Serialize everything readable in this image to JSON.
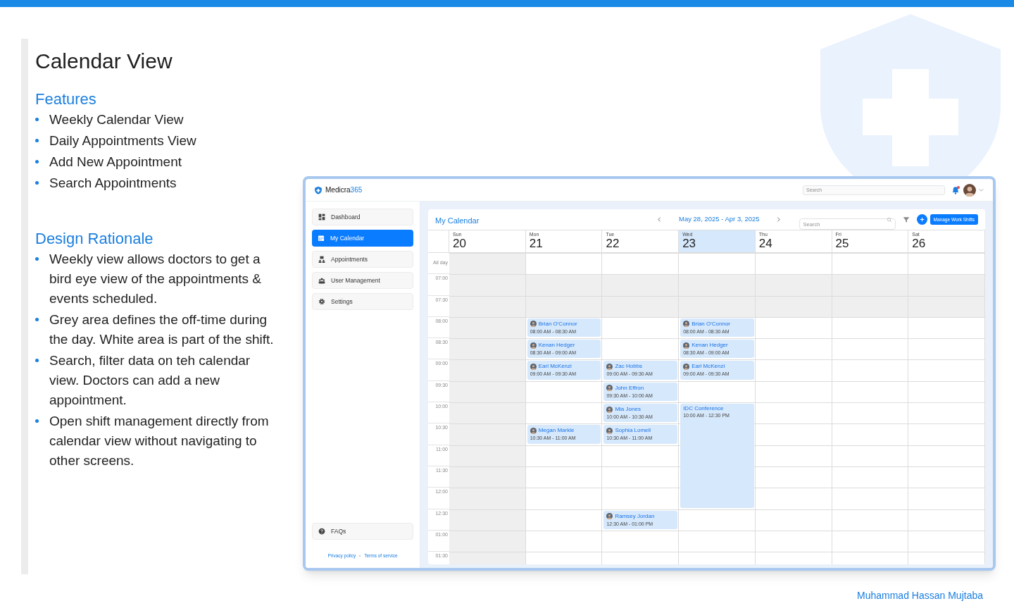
{
  "slide": {
    "title": "Calendar View",
    "sections": [
      {
        "heading": "Features",
        "bullets": [
          "Weekly Calendar View",
          "Daily Appointments View",
          "Add New Appointment",
          "Search Appointments"
        ]
      },
      {
        "heading": "Design Rationale",
        "bullets": [
          "Weekly view allows doctors to get a bird eye view of the appointments & events scheduled.",
          "Grey area defines the off-time during the day. White area is part of the shift.",
          "Search, filter data on teh calendar view. Doctors can add a new appointment.",
          "Open shift management directly from calendar view without navigating to other screens."
        ]
      }
    ],
    "author": "Muhammad Hassan Mujtaba"
  },
  "app": {
    "brand": {
      "name": "Medicra",
      "suffix": "365"
    },
    "header_search": {
      "placeholder": "Search"
    },
    "notifications": {
      "unread": true
    },
    "sidebar": {
      "items": [
        {
          "label": "Dashboard",
          "selected": false
        },
        {
          "label": "My Calendar",
          "selected": true
        },
        {
          "label": "Appointments",
          "selected": false
        },
        {
          "label": "User Management",
          "selected": false
        },
        {
          "label": "Settings",
          "selected": false
        }
      ],
      "footer_items": [
        {
          "label": "FAQs",
          "selected": false
        }
      ],
      "links": [
        "Privacy policy",
        "Terms of service"
      ]
    },
    "calendar": {
      "title": "My Calendar",
      "range": "May 28, 2025 - Apr 3, 2025",
      "search": {
        "placeholder": "Search"
      },
      "button": "Manage Work Shifts",
      "days": [
        {
          "weekday": "Sun",
          "date": "20",
          "selected": false,
          "greyed": true
        },
        {
          "weekday": "Mon",
          "date": "21",
          "selected": false,
          "greyed": false
        },
        {
          "weekday": "Tue",
          "date": "22",
          "selected": false,
          "greyed": false
        },
        {
          "weekday": "Wed",
          "date": "23",
          "selected": true,
          "greyed": false
        },
        {
          "weekday": "Thu",
          "date": "24",
          "selected": false,
          "greyed": false
        },
        {
          "weekday": "Fri",
          "date": "25",
          "selected": false,
          "greyed": false
        },
        {
          "weekday": "Sat",
          "date": "26",
          "selected": false,
          "greyed": false
        }
      ],
      "rows": [
        {
          "label": "All day",
          "kind": "all_day",
          "greyed": false,
          "cells": [
            null,
            null,
            null,
            null,
            null,
            null,
            null
          ]
        },
        {
          "label": "07:00",
          "kind": "time",
          "greyed": true,
          "cells": [
            null,
            null,
            null,
            null,
            null,
            null,
            null
          ]
        },
        {
          "label": "07:30",
          "kind": "time",
          "greyed": true,
          "cells": [
            null,
            null,
            null,
            null,
            null,
            null,
            null
          ]
        },
        {
          "label": "08:00",
          "kind": "time",
          "greyed": false,
          "cells": [
            null,
            {
              "kind": "appointment",
              "name": "Brian O'Connor",
              "time": "08:00 AM - 08:30 AM"
            },
            null,
            {
              "kind": "appointment",
              "name": "Brian O'Connor",
              "time": "08:00 AM - 08:30 AM"
            },
            null,
            null,
            null
          ]
        },
        {
          "label": "08:30",
          "kind": "time",
          "greyed": false,
          "cells": [
            null,
            {
              "kind": "appointment",
              "name": "Kenan Hedger",
              "time": "08:30 AM - 09:00 AM"
            },
            null,
            {
              "kind": "appointment",
              "name": "Kenan Hedger",
              "time": "08:30 AM - 09:00 AM"
            },
            null,
            null,
            null
          ]
        },
        {
          "label": "09:00",
          "kind": "time",
          "greyed": false,
          "cells": [
            null,
            {
              "kind": "appointment",
              "name": "Earl McKenzi",
              "time": "09:00 AM - 09:30 AM"
            },
            {
              "kind": "appointment",
              "name": "Zac Hobbs",
              "time": "09:00 AM - 09:30 AM"
            },
            {
              "kind": "appointment",
              "name": "Earl McKenzi",
              "time": "09:00 AM - 09:30 AM"
            },
            null,
            null,
            null
          ]
        },
        {
          "label": "09:30",
          "kind": "time",
          "greyed": false,
          "cells": [
            null,
            null,
            {
              "kind": "appointment",
              "name": "John Effron",
              "time": "09:30 AM - 10:00 AM"
            },
            null,
            null,
            null,
            null
          ]
        },
        {
          "label": "10:00",
          "kind": "time",
          "greyed": false,
          "cells": [
            null,
            null,
            {
              "kind": "appointment",
              "name": "Mia Jones",
              "time": "10:00 AM - 10:30 AM"
            },
            {
              "kind": "event",
              "name": "IDC Conference",
              "time": "10:00 AM - 12:30 PM"
            },
            null,
            null,
            null
          ]
        },
        {
          "label": "10:30",
          "kind": "time",
          "greyed": false,
          "cells": [
            null,
            {
              "kind": "appointment",
              "name": "Megan Markle",
              "time": "10:30 AM - 11:00 AM"
            },
            {
              "kind": "appointment",
              "name": "Sophia Lomeli",
              "time": "10:30 AM - 11:00 AM"
            },
            {
              "kind": "continued"
            },
            null,
            null,
            null
          ]
        },
        {
          "label": "11:00",
          "kind": "time",
          "greyed": false,
          "cells": [
            null,
            null,
            null,
            {
              "kind": "continued"
            },
            null,
            null,
            null
          ]
        },
        {
          "label": "11:30",
          "kind": "time",
          "greyed": false,
          "cells": [
            null,
            null,
            null,
            {
              "kind": "continued"
            },
            null,
            null,
            null
          ]
        },
        {
          "label": "12:00",
          "kind": "time",
          "greyed": false,
          "cells": [
            null,
            null,
            null,
            {
              "kind": "continued"
            },
            null,
            null,
            null
          ]
        },
        {
          "label": "12:30",
          "kind": "time",
          "greyed": false,
          "cells": [
            null,
            null,
            {
              "kind": "appointment",
              "name": "Ramsey Jordan",
              "time": "12:30 AM - 01:00 PM"
            },
            null,
            null,
            null,
            null
          ]
        },
        {
          "label": "01:00",
          "kind": "time",
          "greyed": false,
          "cells": [
            null,
            null,
            null,
            null,
            null,
            null,
            null
          ]
        },
        {
          "label": "01:30",
          "kind": "time",
          "greyed": false,
          "cells": [
            null,
            null,
            null,
            null,
            null,
            null,
            null
          ]
        }
      ]
    }
  }
}
